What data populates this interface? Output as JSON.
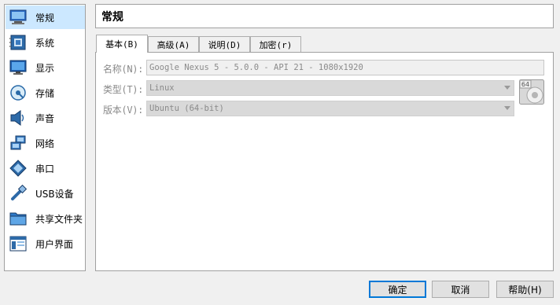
{
  "sidebar": {
    "items": [
      {
        "label": "常规",
        "icon": "monitor-general-icon",
        "selected": true
      },
      {
        "label": "系统",
        "icon": "motherboard-chip-icon"
      },
      {
        "label": "显示",
        "icon": "display-monitor-icon"
      },
      {
        "label": "存储",
        "icon": "disk-storage-icon"
      },
      {
        "label": "声音",
        "icon": "speaker-icon"
      },
      {
        "label": "网络",
        "icon": "network-icon"
      },
      {
        "label": "串口",
        "icon": "serial-port-icon"
      },
      {
        "label": "USB设备",
        "icon": "usb-plug-icon"
      },
      {
        "label": "共享文件夹",
        "icon": "shared-folder-icon"
      },
      {
        "label": "用户界面",
        "icon": "user-interface-window-icon"
      }
    ]
  },
  "page": {
    "title": "常规"
  },
  "tabs": [
    {
      "label": "基本(B)",
      "active": true
    },
    {
      "label": "高级(A)"
    },
    {
      "label": "说明(D)"
    },
    {
      "label": "加密(r)"
    }
  ],
  "form": {
    "name_label": "名称(N):",
    "name_value": "Google Nexus 5 - 5.0.0 - API 21 - 1080x1920",
    "type_label": "类型(T):",
    "type_value": "Linux",
    "version_label": "版本(V):",
    "version_value": "Ubuntu (64-bit)",
    "os_badge": "64"
  },
  "buttons": {
    "ok": "确定",
    "cancel": "取消",
    "help": "帮助(H)"
  },
  "colors": {
    "selection": "#cce8ff",
    "default_button_border": "#0078d7"
  }
}
